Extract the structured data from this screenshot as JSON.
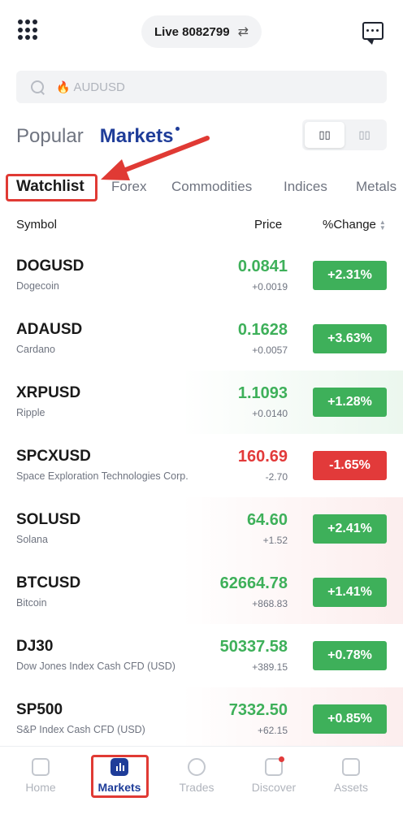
{
  "header": {
    "account_label": "Live 8082799",
    "swap_icon": "swap-arrows-icon",
    "menu_icon": "grid-menu-icon",
    "message_icon": "chat-icon"
  },
  "search": {
    "placeholder": "AUDUSD",
    "icon": "search-icon",
    "hot_icon": "fire-icon"
  },
  "section_tabs": {
    "popular": "Popular",
    "markets": "Markets"
  },
  "category_tabs": [
    "Watchlist",
    "Forex",
    "Commodities",
    "Indices",
    "Metals"
  ],
  "table": {
    "headers": {
      "symbol": "Symbol",
      "price": "Price",
      "change": "%Change"
    },
    "rows": [
      {
        "symbol": "DOGUSD",
        "name": "Dogecoin",
        "price": "0.0841",
        "abs": "+0.0019",
        "pct": "+2.31%",
        "dir": "up"
      },
      {
        "symbol": "ADAUSD",
        "name": "Cardano",
        "price": "0.1628",
        "abs": "+0.0057",
        "pct": "+3.63%",
        "dir": "up"
      },
      {
        "symbol": "XRPUSD",
        "name": "Ripple",
        "price": "1.1093",
        "abs": "+0.0140",
        "pct": "+1.28%",
        "dir": "up"
      },
      {
        "symbol": "SPCXUSD",
        "name": "Space Exploration Technologies Corp.",
        "price": "160.69",
        "abs": "-2.70",
        "pct": "-1.65%",
        "dir": "down"
      },
      {
        "symbol": "SOLUSD",
        "name": "Solana",
        "price": "64.60",
        "abs": "+1.52",
        "pct": "+2.41%",
        "dir": "up"
      },
      {
        "symbol": "BTCUSD",
        "name": "Bitcoin",
        "price": "62664.78",
        "abs": "+868.83",
        "pct": "+1.41%",
        "dir": "up"
      },
      {
        "symbol": "DJ30",
        "name": "Dow Jones Index Cash CFD (USD)",
        "price": "50337.58",
        "abs": "+389.15",
        "pct": "+0.78%",
        "dir": "up"
      },
      {
        "symbol": "SP500",
        "name": "S&P Index Cash CFD (USD)",
        "price": "7332.50",
        "abs": "+62.15",
        "pct": "+0.85%",
        "dir": "up"
      }
    ]
  },
  "bottom_nav": [
    {
      "label": "Home",
      "icon": "home-chart-icon"
    },
    {
      "label": "Markets",
      "icon": "markets-bars-icon"
    },
    {
      "label": "Trades",
      "icon": "trades-trend-icon"
    },
    {
      "label": "Discover",
      "icon": "discover-icon"
    },
    {
      "label": "Assets",
      "icon": "assets-wallet-icon"
    }
  ],
  "colors": {
    "brand": "#1f3d99",
    "up": "#3eb05a",
    "down": "#e23a3a",
    "annotation": "#e03a34"
  }
}
